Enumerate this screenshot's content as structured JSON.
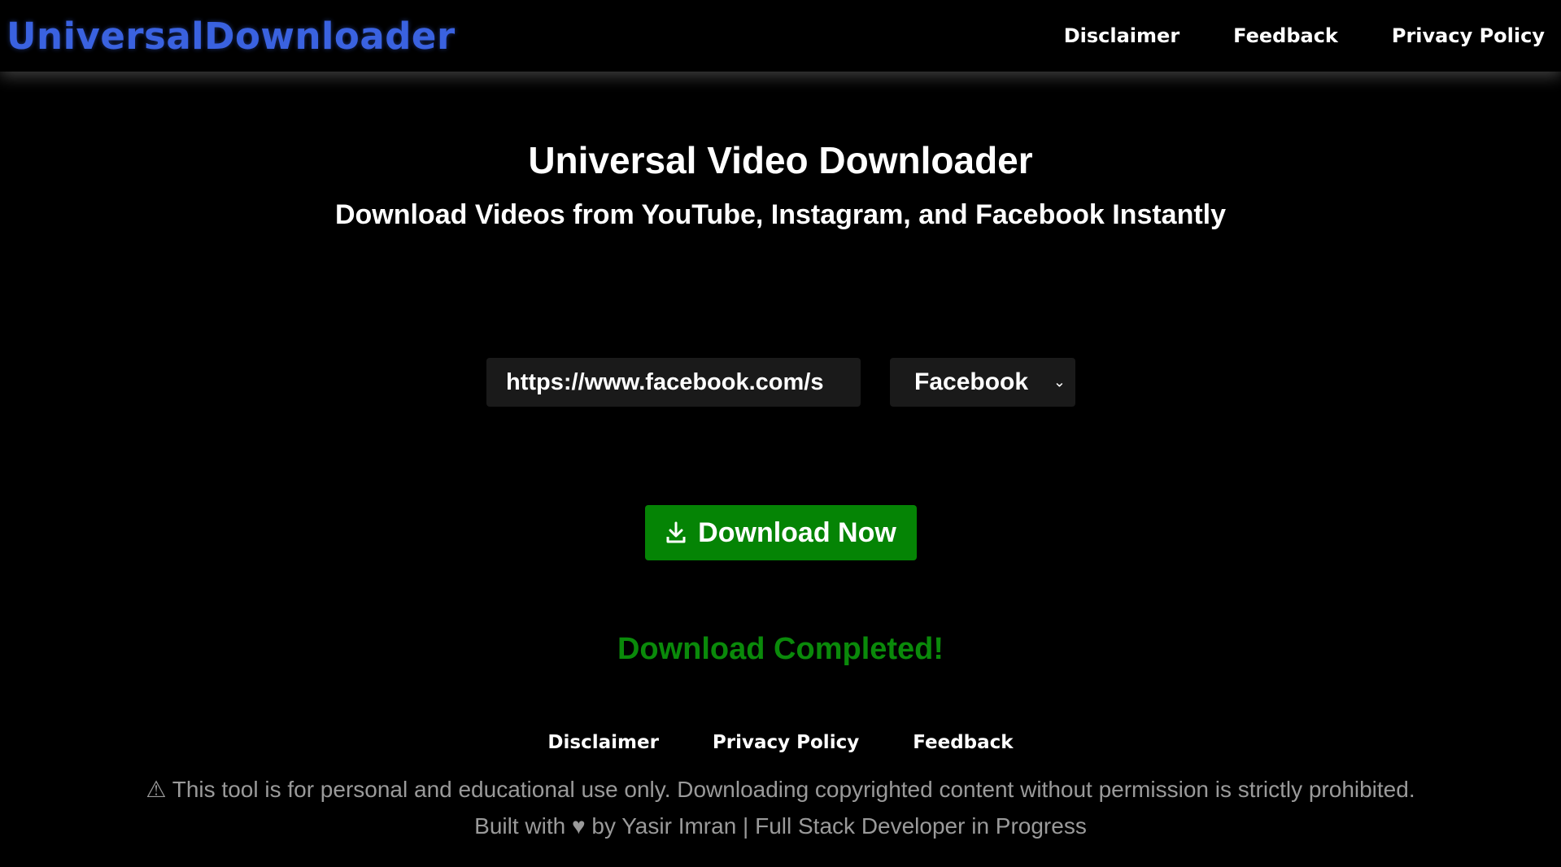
{
  "header": {
    "brand": "UniversalDownloader",
    "nav": [
      "Disclaimer",
      "Feedback",
      "Privacy Policy"
    ]
  },
  "main": {
    "title": "Universal Video Downloader",
    "subtitle": "Download Videos from YouTube, Instagram, and Facebook Instantly",
    "url_value": "https://www.facebook.com/s",
    "platform_selected": "Facebook",
    "download_button": "Download Now",
    "status": "Download Completed!"
  },
  "footer": {
    "nav": [
      "Disclaimer",
      "Privacy Policy",
      "Feedback"
    ],
    "disclaimer": "⚠ This tool is for personal and educational use only. Downloading copyrighted content without permission is strictly prohibited.",
    "credit": "Built with ♥ by Yasir Imran | Full Stack Developer in Progress"
  },
  "colors": {
    "background": "#000000",
    "brand": "#3a62e0",
    "button": "#058405",
    "status": "#0a8a0a",
    "muted_text": "#9a9a9a",
    "field_bg": "#1a1a1a"
  },
  "icons": {
    "download_button_icon": "download-icon",
    "select_arrow": "chevron-down-icon"
  }
}
